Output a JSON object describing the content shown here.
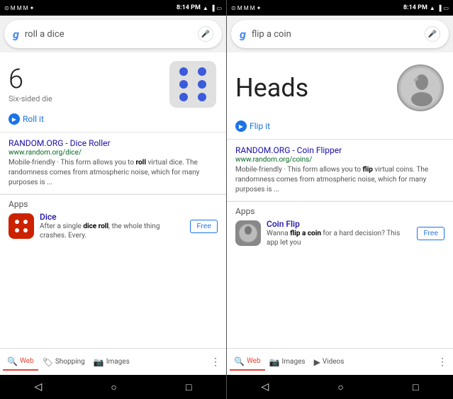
{
  "panels": [
    {
      "id": "dice-panel",
      "status": {
        "time": "8:14 PM",
        "left_icons": [
          "notification",
          "gmail1",
          "gmail2",
          "gmail3"
        ],
        "right_icons": [
          "signal",
          "wifi",
          "network",
          "battery"
        ]
      },
      "search": {
        "query": "roll a dice",
        "mic_label": "mic"
      },
      "result_card": {
        "number": "6",
        "label": "Six-sided die",
        "action_label": "Roll it"
      },
      "search_result": {
        "title": "RANDOM.ORG - Dice Roller",
        "url_base": "www.random.org/",
        "url_path": "dice/",
        "snippet": "Mobile-friendly · This form allows you to roll virtual dice. The randomness comes from atmospheric noise, which for many purposes is ..."
      },
      "apps": {
        "section_label": "Apps",
        "app_name": "Dice",
        "app_desc": "After a single dice roll, the whole thing crashes. Every.",
        "free_label": "Free"
      },
      "bottom_nav": {
        "tabs": [
          {
            "label": "Web",
            "active": true
          },
          {
            "label": "Shopping",
            "active": false
          },
          {
            "label": "Images",
            "active": false
          }
        ],
        "dots": "⋮"
      }
    },
    {
      "id": "coin-panel",
      "status": {
        "time": "8:14 PM"
      },
      "search": {
        "query": "flip a coin",
        "mic_label": "mic"
      },
      "result_card": {
        "result_text": "Heads",
        "action_label": "Flip it"
      },
      "search_result": {
        "title": "RANDOM.ORG - Coin Flipper",
        "url_base": "www.random.org/",
        "url_path": "coins/",
        "snippet": "Mobile-friendly · This form allows you to flip virtual coins. The randomness comes from atmospheric noise, which for many purposes is ..."
      },
      "apps": {
        "section_label": "Apps",
        "app_name": "Coin Flip",
        "app_desc": "Wanna flip a coin for a hard decision? This app let you",
        "free_label": "Free"
      },
      "bottom_nav": {
        "tabs": [
          {
            "label": "Web",
            "active": true
          },
          {
            "label": "Images",
            "active": false
          },
          {
            "label": "Videos",
            "active": false
          }
        ],
        "dots": "⋮"
      }
    }
  ]
}
